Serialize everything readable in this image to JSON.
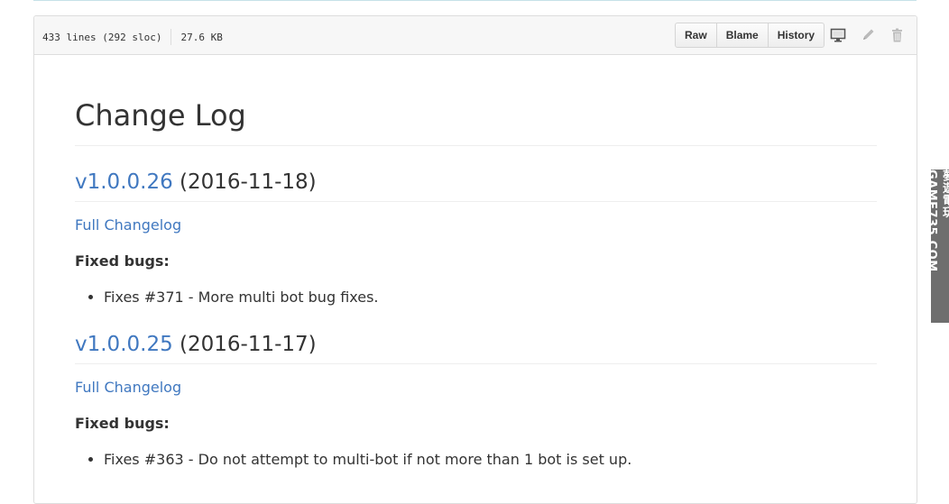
{
  "file_header": {
    "lines": "433 lines (292 sloc)",
    "size": "27.6 KB",
    "buttons": [
      "Raw",
      "Blame",
      "History"
    ],
    "icons": [
      "desktop-icon",
      "pencil-icon",
      "trash-icon"
    ]
  },
  "content": {
    "title": "Change Log",
    "releases": [
      {
        "version": "v1.0.0.26",
        "date": " (2016-11-18)",
        "changelog_link": "Full Changelog",
        "section_label": "Fixed bugs:",
        "items": [
          "Fixes #371 - More multi bot bug fixes."
        ]
      },
      {
        "version": "v1.0.0.25",
        "date": " (2016-11-17)",
        "changelog_link": "Full Changelog",
        "section_label": "Fixed bugs:",
        "items": [
          "Fixes #363 - Do not attempt to multi-bot if not more than 1 bot is set up."
        ]
      }
    ]
  },
  "watermark": "夢遊電玩 GAME735.COM",
  "colors": {
    "link": "#4078c0",
    "text": "#333333",
    "header_bg": "#f7f7f7",
    "border": "#dddddd"
  }
}
